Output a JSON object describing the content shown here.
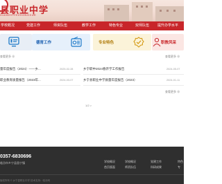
{
  "header": {
    "school_name": "县职业中学",
    "school_subtitle": "XIANZHIYEZHONGXUE"
  },
  "nav": {
    "items": [
      {
        "label": "学校概况"
      },
      {
        "label": "党建工作"
      },
      {
        "label": "师资队伍"
      },
      {
        "label": "教学工作"
      },
      {
        "label": "特色专业"
      },
      {
        "label": "双师队伍"
      },
      {
        "label": "提升办学水平"
      }
    ]
  },
  "quick_links": {
    "items": [
      {
        "label": "",
        "icon": "monitor-icon"
      },
      {
        "label": "德育工作",
        "icon": "radio-icon"
      },
      {
        "label": "专业特色",
        "icon": "check-badge-icon"
      },
      {
        "label": "职教风采",
        "icon": "student-icon"
      }
    ]
  },
  "news_left": {
    "more": "查看更多 ⊕",
    "items": [
      {
        "title": "量年度报告（2024）——乡...",
        "date": "2025-02-28"
      },
      {
        "title": "职业教育质量报告（2023年...",
        "date": "2024-03-07"
      }
    ]
  },
  "news_right": {
    "more": "查看更多 ⊕",
    "items": [
      {
        "title": "乡宁职中2024春开学工作报告",
        "date": "2024-05-07"
      },
      {
        "title": "乡宁县职业中学质量年度报告（2023）",
        "date": "2024-01-11"
      }
    ]
  },
  "pager": {
    "text": "1/2 >"
  },
  "footer": {
    "phone": "0357-6830696",
    "address": "临汾市乡宁县昌宁镇",
    "links": [
      {
        "label": "学校概况"
      },
      {
        "label": "首页版面"
      },
      {
        "label": "学校概况"
      },
      {
        "label": "师资队伍"
      },
      {
        "label": "党建工作"
      },
      {
        "label": "科研成果"
      },
      {
        "label": "特色"
      },
      {
        "label": "专"
      }
    ],
    "copyright": "版权所有 © 乡宁县职业中学  技术支持：临汾网"
  }
}
